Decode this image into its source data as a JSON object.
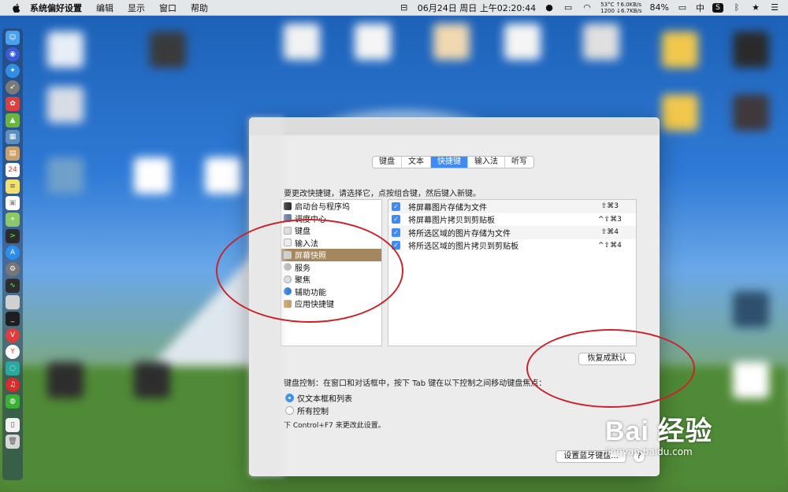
{
  "menubar": {
    "app_name": "系统偏好设置",
    "items": [
      "编辑",
      "显示",
      "窗口",
      "帮助"
    ],
    "sensor_top": "53°C ↑6.0KB/s",
    "sensor_bottom": "1200 ↓6.7KB/s",
    "battery": "84%",
    "clock": "06月24日 周日 上午02:20:44",
    "input_method": "中"
  },
  "window": {
    "tabs": [
      "键盘",
      "文本",
      "快捷键",
      "输入法",
      "听写"
    ],
    "active_tab": "快捷键",
    "instruction": "要更改快捷键，请选择它，点按组合键，然后键入新键。",
    "categories": [
      "启动台与程序坞",
      "调度中心",
      "键盘",
      "输入法",
      "屏幕快照",
      "服务",
      "聚焦",
      "辅助功能",
      "应用快捷键"
    ],
    "selected_category": "屏幕快照",
    "shortcuts": [
      {
        "name": "将屏幕图片存储为文件",
        "key": "⇧⌘3",
        "checked": true
      },
      {
        "name": "将屏幕图片拷贝到剪贴板",
        "key": "^⇧⌘3",
        "checked": true
      },
      {
        "name": "将所选区域的图片存储为文件",
        "key": "⇧⌘4",
        "checked": true
      },
      {
        "name": "将所选区域的图片拷贝到剪贴板",
        "key": "^⇧⌘4",
        "checked": true
      }
    ],
    "restore_label": "恢复成默认",
    "keyboard_control_text": "键盘控制：在窗口和对话框中，按下 Tab 键在以下控制之间移动键盘焦点：",
    "radio_options": [
      "仅文本框和列表",
      "所有控制"
    ],
    "selected_radio": "仅文本框和列表",
    "hint": "下 Control+F7 来更改此设置。",
    "bluetooth_label": "设置蓝牙键盘...",
    "help_label": "?"
  },
  "watermark": {
    "brand": "Bai 经验",
    "url": "jingyan.baidu.com"
  },
  "colors": {
    "accent": "#3d8cf5",
    "selected_row": "#a3885f",
    "annotation": "#c8242b"
  }
}
